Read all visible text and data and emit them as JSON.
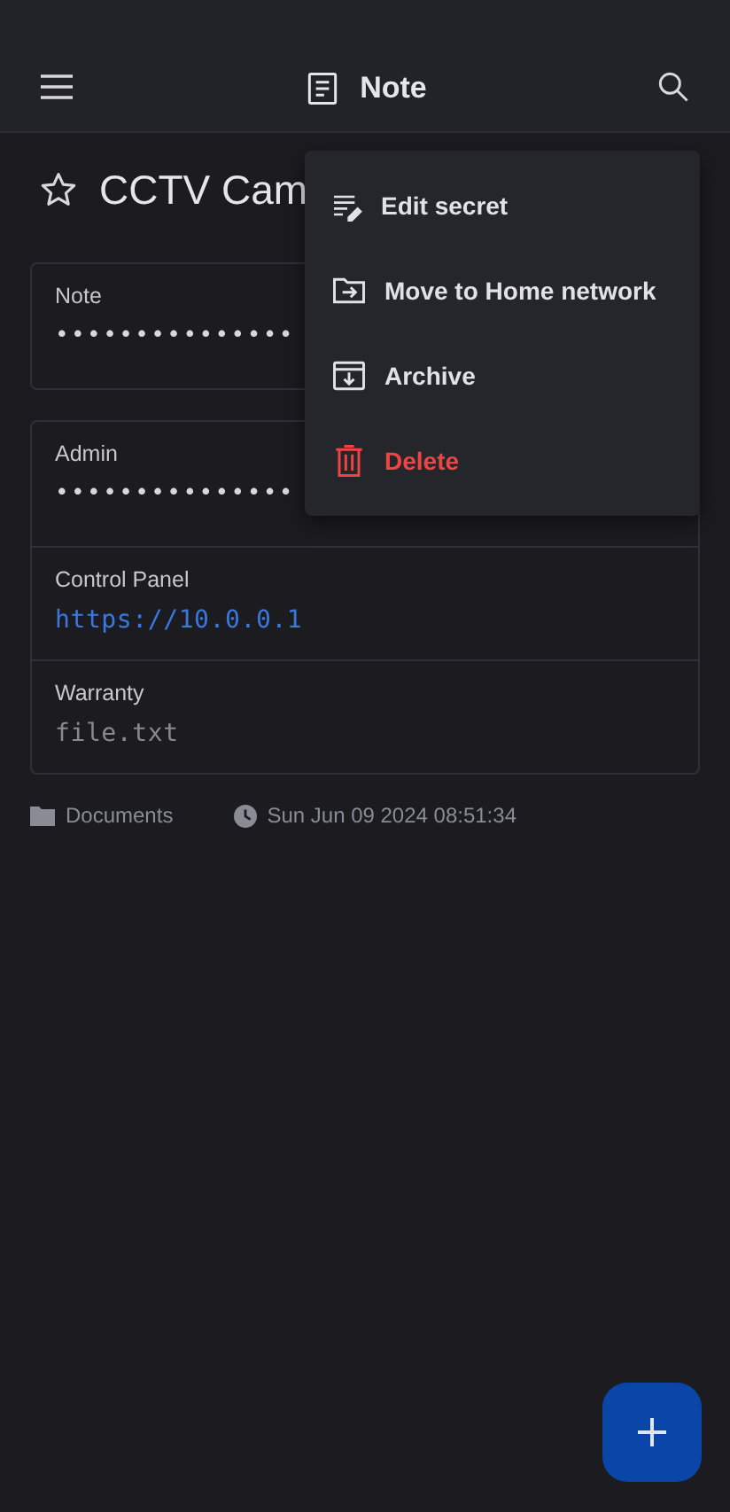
{
  "app_bar": {
    "title": "Note"
  },
  "item": {
    "title": "CCTV Cam",
    "favorite": false
  },
  "cards": [
    {
      "fields": [
        {
          "label": "Note",
          "kind": "masked",
          "value": "•••••••••••••••"
        }
      ]
    },
    {
      "fields": [
        {
          "label": "Admin",
          "kind": "masked",
          "value": "•••••••••••••••"
        },
        {
          "label": "Control Panel",
          "kind": "link",
          "value": "https://10.0.0.1"
        },
        {
          "label": "Warranty",
          "kind": "file",
          "value": "file.txt"
        }
      ]
    }
  ],
  "meta": {
    "folder": "Documents",
    "modified": "Sun Jun 09 2024 08:51:34"
  },
  "menu": [
    {
      "label": "Edit secret",
      "kind": "edit"
    },
    {
      "label": "Move to Home network",
      "kind": "move"
    },
    {
      "label": "Archive",
      "kind": "archive"
    },
    {
      "label": "Delete",
      "kind": "delete"
    }
  ]
}
